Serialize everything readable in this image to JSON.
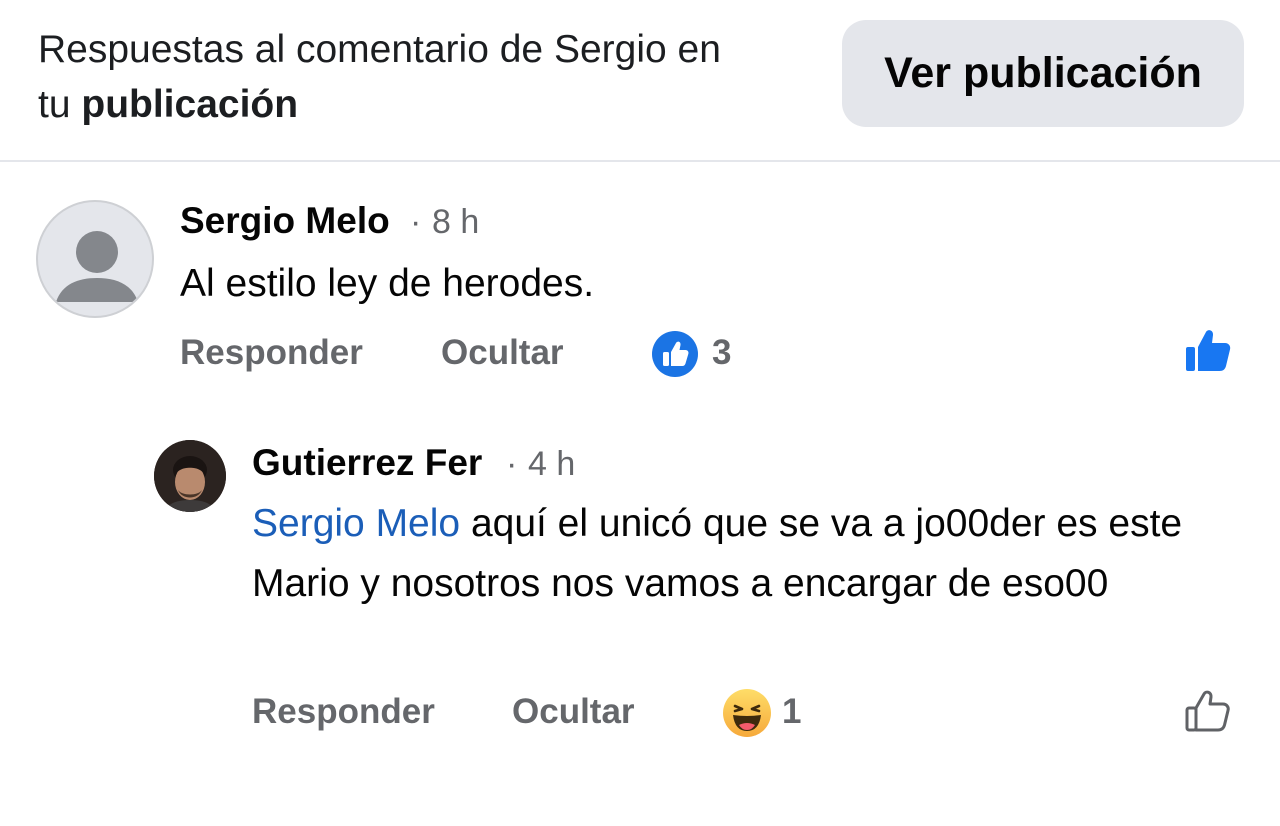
{
  "header": {
    "title_line1": "Respuestas al comentario de Sergio en",
    "title_prefix": "tu",
    "title_bold": "publicación",
    "view_button": "Ver publicación"
  },
  "comment": {
    "author": "Sergio Melo",
    "separator": "·",
    "time": "8 h",
    "text": "Al estilo ley de herodes.",
    "reply_label": "Responder",
    "hide_label": "Ocultar",
    "reaction_icon": "like-reaction-icon",
    "reaction_count": "3",
    "like_icon": "thumbs-up-filled-icon",
    "like_color": "#1877f2"
  },
  "reply": {
    "author": "Gutierrez Fer",
    "separator": "·",
    "time": "4 h",
    "mention": "Sergio Melo",
    "text": " aquí el unicó que se va a jo00der es este Mario y nosotros nos vamos a encargar de eso00",
    "reply_label": "Responder",
    "hide_label": "Ocultar",
    "reaction_icon": "haha-reaction-icon",
    "reaction_count": "1",
    "like_icon": "thumbs-up-outline-icon"
  }
}
